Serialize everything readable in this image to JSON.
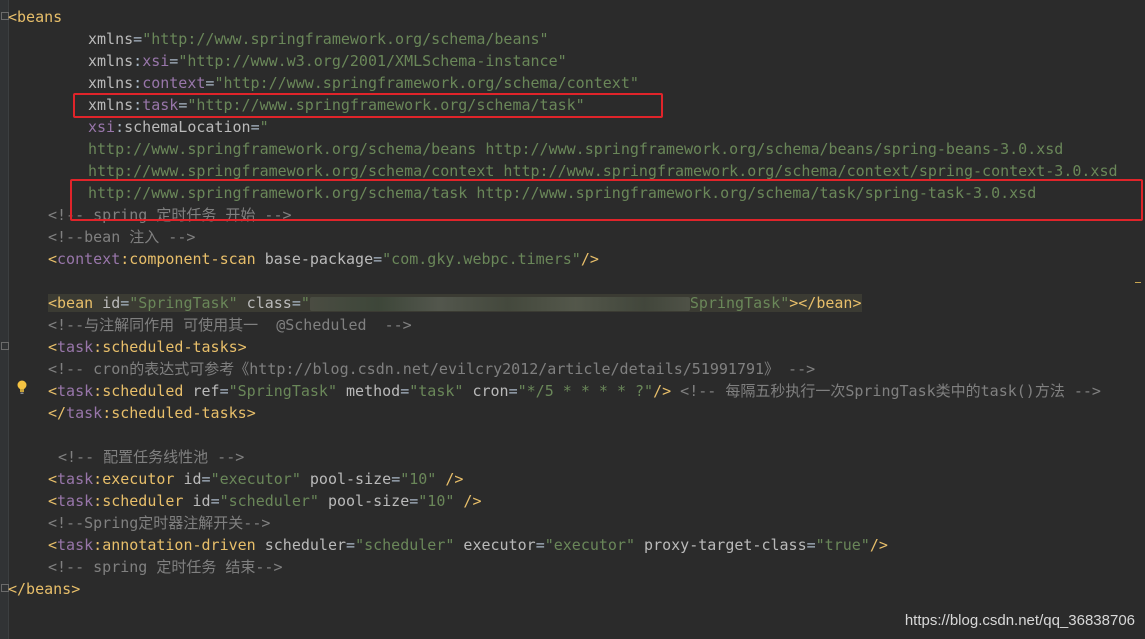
{
  "code": {
    "l1": {
      "open": "<beans"
    },
    "l2": {
      "attr": "xmlns",
      "eq": "=",
      "val": "\"http://www.springframework.org/schema/beans\""
    },
    "l3": {
      "attr": "xmlns",
      "colon": ":",
      "ns": "xsi",
      "eq": "=",
      "val": "\"http://www.w3.org/2001/XMLSchema-instance\""
    },
    "l4": {
      "attr": "xmlns",
      "colon": ":",
      "ns": "context",
      "eq": "=",
      "val": "\"http://www.springframework.org/schema/context\""
    },
    "l5": {
      "attr": "xmlns",
      "colon": ":",
      "ns": "task",
      "eq": "=",
      "val": "\"http://www.springframework.org/schema/task\""
    },
    "l6": {
      "ns": "xsi",
      "colon": ":",
      "attr": "schemaLocation",
      "eq": "=",
      "val": "\""
    },
    "l7": {
      "val": "http://www.springframework.org/schema/beans http://www.springframework.org/schema/beans/spring-beans-3.0.xsd"
    },
    "l8": {
      "val": "http://www.springframework.org/schema/context http://www.springframework.org/schema/context/spring-context-3.0.xsd"
    },
    "l9": {
      "val": "http://www.springframework.org/schema/task http://www.springframework.org/schema/task/spring-task-3.0.xsd"
    },
    "l10": {
      "comment": "<!-- spring 定时任务 开始 -->"
    },
    "l11": {
      "comment": "<!--bean 注入 -->"
    },
    "l12": {
      "lt": "<",
      "ns": "context",
      "colon": ":",
      "tag": "component-scan",
      "attr": " base-package",
      "eq": "=",
      "val": "\"com.gky.webpc.timers\"",
      "close": "/>"
    },
    "l14": {
      "open": "<bean",
      "attr1": " id",
      "eq1": "=",
      "val1": "\"SpringTask\"",
      "attr2": " class",
      "eq2": "=",
      "val2a": "\"",
      "val2b": "SpringTask\"",
      "close": "></bean>"
    },
    "l15": {
      "comment": "<!--与注解同作用 可使用其一  @Scheduled  -->"
    },
    "l16": {
      "lt": "<",
      "ns": "task",
      "colon": ":",
      "tag": "scheduled-tasks",
      "close": ">"
    },
    "l17": {
      "comment": "<!-- cron的表达式可参考《http://blog.csdn.net/evilcry2012/article/details/51991791》 -->"
    },
    "l18": {
      "lt": "<",
      "ns": "task",
      "colon": ":",
      "tag": "scheduled",
      "attr1": " ref",
      "eq1": "=",
      "val1": "\"SpringTask\"",
      "attr2": " method",
      "eq2": "=",
      "val2": "\"task\"",
      "attr3": " cron",
      "eq3": "=",
      "val3": "\"*/5 * * * * ?\"",
      "close": "/>",
      "comment": " <!-- 每隔五秒执行一次SpringTask类中的task()方法 -->"
    },
    "l19": {
      "lt": "</",
      "ns": "task",
      "colon": ":",
      "tag": "scheduled-tasks",
      "close": ">"
    },
    "l21": {
      "comment": "<!-- 配置任务线性池 -->"
    },
    "l22": {
      "lt": "<",
      "ns": "task",
      "colon": ":",
      "tag": "executor",
      "attr1": " id",
      "eq1": "=",
      "val1": "\"executor\"",
      "attr2": " pool-size",
      "eq2": "=",
      "val2": "\"10\"",
      "close": " />"
    },
    "l23": {
      "lt": "<",
      "ns": "task",
      "colon": ":",
      "tag": "scheduler",
      "attr1": " id",
      "eq1": "=",
      "val1": "\"scheduler\"",
      "attr2": " pool-size",
      "eq2": "=",
      "val2": "\"10\"",
      "close": " />"
    },
    "l24": {
      "comment": "<!--Spring定时器注解开关-->"
    },
    "l25": {
      "lt": "<",
      "ns": "task",
      "colon": ":",
      "tag": "annotation-driven",
      "attr1": " scheduler",
      "eq1": "=",
      "val1": "\"scheduler\"",
      "attr2": " executor",
      "eq2": "=",
      "val2": "\"executor\"",
      "attr3": " proxy-target-class",
      "eq3": "=",
      "val3": "\"true\"",
      "close": "/>"
    },
    "l26": {
      "comment": "<!-- spring 定时任务 结束-->"
    },
    "l27": {
      "open": "</beans>"
    }
  },
  "watermark": "https://blog.csdn.net/qq_36838706",
  "icons": {
    "bulb": "lightbulb-icon"
  },
  "colors": {
    "background": "#2b2b2b",
    "tag": "#e8bf6a",
    "namespace": "#9876aa",
    "string": "#6a8759",
    "comment": "#808080",
    "highlight_box": "#e0242a"
  }
}
